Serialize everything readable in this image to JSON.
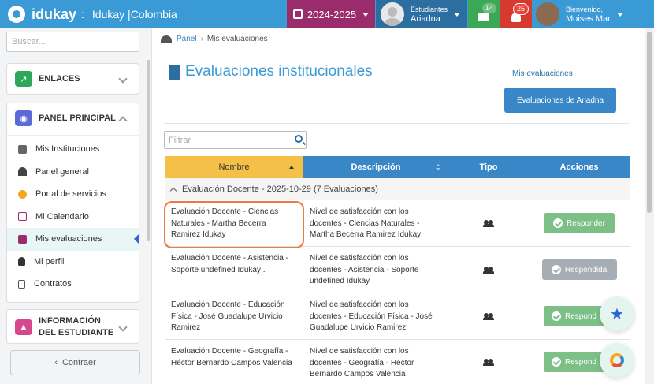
{
  "topbar": {
    "brand": "idukay",
    "separator": ":",
    "institution": "Idukay |Colombia",
    "year": "2024-2025",
    "user_role": "Estudiantes",
    "user_name": "Ariadna",
    "messages_count": "14",
    "notifications_count": "25",
    "welcome_label": "Bienvenido,",
    "welcome_name": "Moises Mar"
  },
  "sidebar": {
    "search_placeholder": "Buscar...",
    "enlaces": "ENLACES",
    "panel_principal": "PANEL PRINCIPAL",
    "items": [
      {
        "label": "Mis Instituciones",
        "icon": "institution-icon",
        "color": "#555"
      },
      {
        "label": "Panel general",
        "icon": "dashboard-icon",
        "color": "#444"
      },
      {
        "label": "Portal de servicios",
        "icon": "services-icon",
        "color": "#f5a623"
      },
      {
        "label": "Mi Calendario",
        "icon": "calendar-icon",
        "color": "#9b2c6b"
      },
      {
        "label": "Mis evaluaciones",
        "icon": "evaluations-icon",
        "color": "#9b2c6b"
      },
      {
        "label": "Mi perfil",
        "icon": "user-icon",
        "color": "#333"
      },
      {
        "label": "Contratos",
        "icon": "contract-icon",
        "color": "#555"
      }
    ],
    "info_estudiante": "INFORMACIÓN DEL ESTUDIANTE",
    "contraer": "Contraer"
  },
  "main": {
    "breadcrumb_home": "Panel",
    "breadcrumb_current": "Mis evaluaciones",
    "title": "Evaluaciones institucionales",
    "link_mis": "Mis evaluaciones",
    "button_ariadna": "Evaluaciones de Ariadna",
    "filter_placeholder": "Filtrar",
    "columns": {
      "nombre": "Nombre",
      "descripcion": "Descripción",
      "tipo": "Tipo",
      "acciones": "Acciones"
    },
    "group_label": "Evaluación Docente - 2025-10-29 (7 Evaluaciones)",
    "rows": [
      {
        "nombre": "Evaluación Docente - Ciencias Naturales - Martha Becerra Ramirez Idukay",
        "descripcion": "Nivel de satisfacción con los docentes - Ciencias Naturales - Martha Becerra Ramirez Idukay",
        "action": "Responder"
      },
      {
        "nombre": "Evaluación Docente - Asistencia - Soporte undefined Idukay .",
        "descripcion": "Nivel de satisfacción con los docentes - Asistencia - Soporte undefined Idukay .",
        "action": "Respondida"
      },
      {
        "nombre": "Evaluación Docente - Educación Física - José Guadalupe Urvicio Ramirez",
        "descripcion": "Nivel de satisfacción con los docentes - Educación Física - José Guadalupe Urvicio Ramirez",
        "action": "Respond"
      },
      {
        "nombre": "Evaluación Docente - Geografía - Héctor Bernardo Campos Valencia",
        "descripcion": "Nivel de satisfacción con los docentes - Geografía - Héctor Bernardo Campos Valencia",
        "action": "Respond"
      }
    ]
  },
  "colors": {
    "primary": "#3a9ad6",
    "accent": "#f5c048",
    "success": "#7cc087",
    "year": "#9b2c6b"
  }
}
